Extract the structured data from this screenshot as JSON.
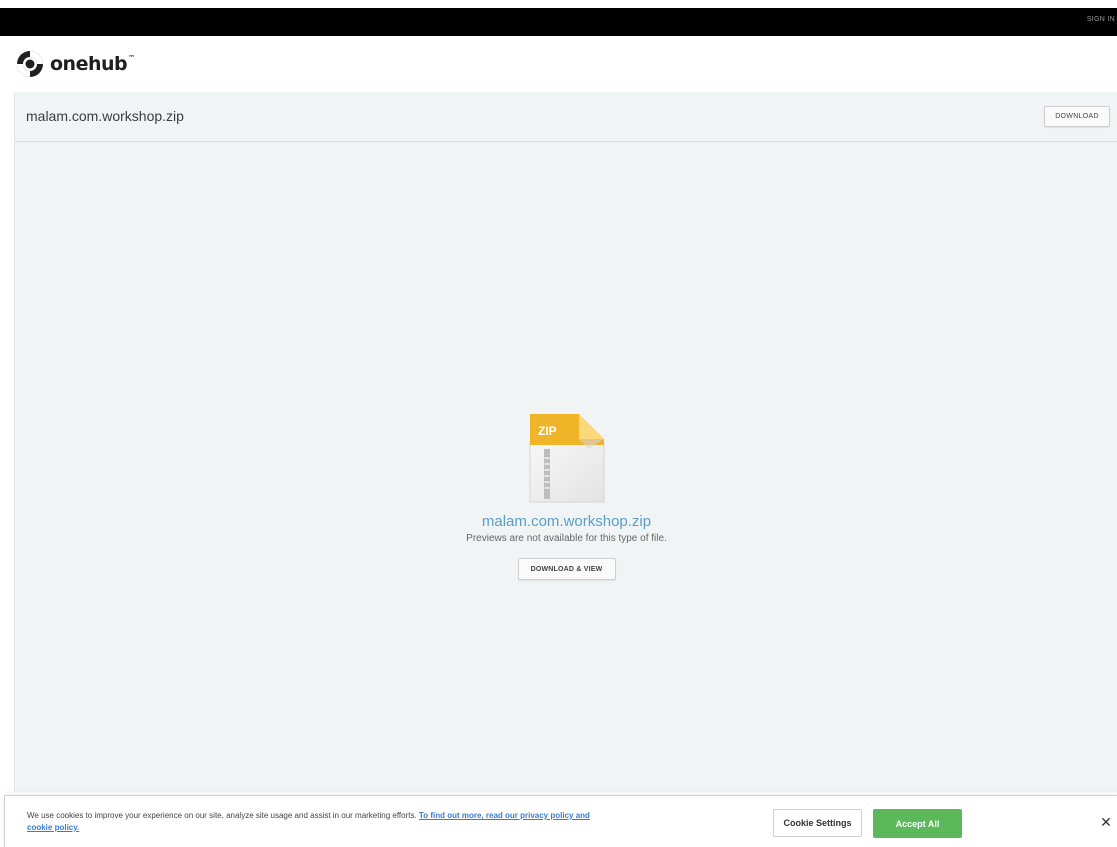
{
  "header": {
    "sign_in_label": "SIGN IN",
    "logo_text": "onehub",
    "logo_mark": "™"
  },
  "file": {
    "title": "malam.com.workshop.zip",
    "download_label": "DOWNLOAD",
    "icon_badge": "ZIP",
    "preview_name": "malam.com.workshop.zip",
    "preview_note": "Previews are not available for this type of file.",
    "download_view_label": "DOWNLOAD & VIEW"
  },
  "cookie_banner": {
    "text": "We use cookies to improve your experience on our site, analyze site usage and assist in our marketing efforts.",
    "link_text": "To find out more, read our privacy policy and cookie policy.",
    "settings_label": "Cookie Settings",
    "accept_label": "Accept All",
    "close_glyph": "✕"
  },
  "colors": {
    "top_bar": "#000000",
    "panel_background": "#f0f4f4",
    "link_blue": "#5b9ec2",
    "accept_green": "#5bb85b",
    "zip_badge": "#f0b428"
  },
  "icons": {
    "logo": "onehub-logo-icon",
    "file_type": "zip-file-icon",
    "close": "close-icon"
  }
}
